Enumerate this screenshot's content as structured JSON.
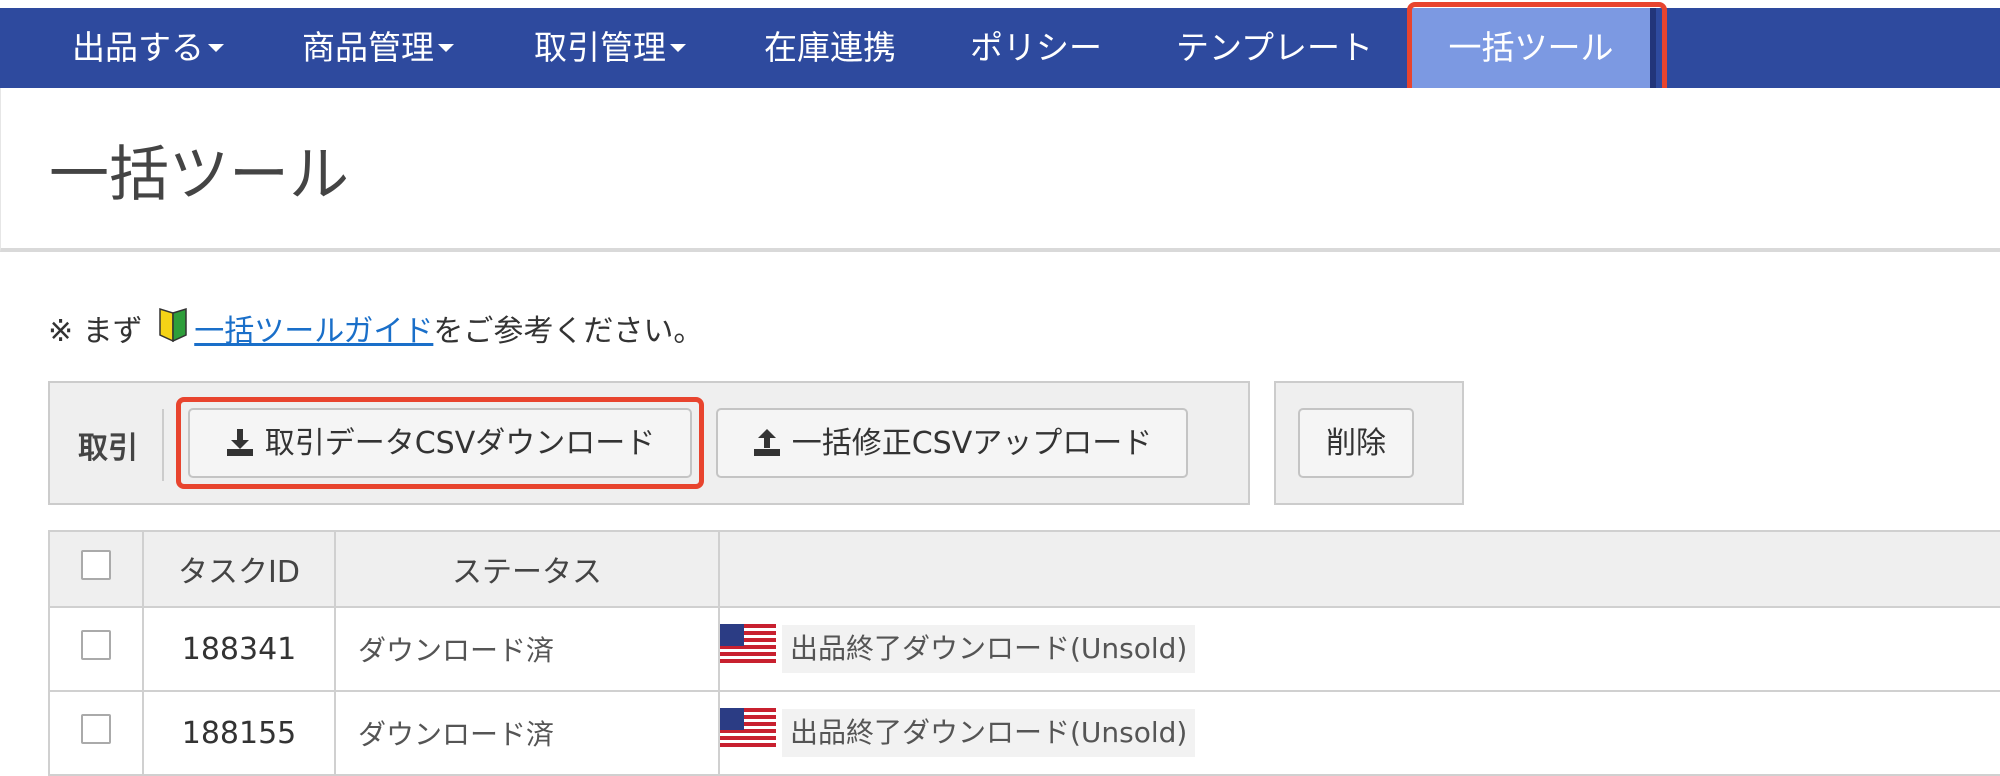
{
  "nav": {
    "items": [
      {
        "label": "出品する",
        "dropdown": true
      },
      {
        "label": "商品管理",
        "dropdown": true
      },
      {
        "label": "取引管理",
        "dropdown": true
      },
      {
        "label": "在庫連携",
        "dropdown": false
      },
      {
        "label": "ポリシー",
        "dropdown": false
      },
      {
        "label": "テンプレート",
        "dropdown": false
      },
      {
        "label": "一括ツール",
        "active": true
      }
    ],
    "active_color": "#7c99e2",
    "bar_color": "#2e4a9e"
  },
  "page": {
    "title": "一括ツール"
  },
  "intro": {
    "prefix": "※ まず",
    "icon": "beginner-mark-icon",
    "link": "一括ツールガイド",
    "suffix": "をご参考ください。"
  },
  "toolbar": {
    "section_label": "取引",
    "download_label": "取引データCSVダウンロード",
    "upload_label": "一括修正CSVアップロード",
    "delete_label": "削除"
  },
  "table": {
    "headers": [
      "タスクID",
      "ステータス",
      ""
    ],
    "rows": [
      {
        "task_id": "188341",
        "status": "ダウンロード済",
        "task": "出品終了ダウンロード(Unsold)",
        "flag": "us-flag-icon"
      },
      {
        "task_id": "188155",
        "status": "ダウンロード済",
        "task": "出品終了ダウンロード(Unsold)",
        "flag": "us-flag-icon"
      }
    ]
  },
  "highlight_color": "#e8442e"
}
